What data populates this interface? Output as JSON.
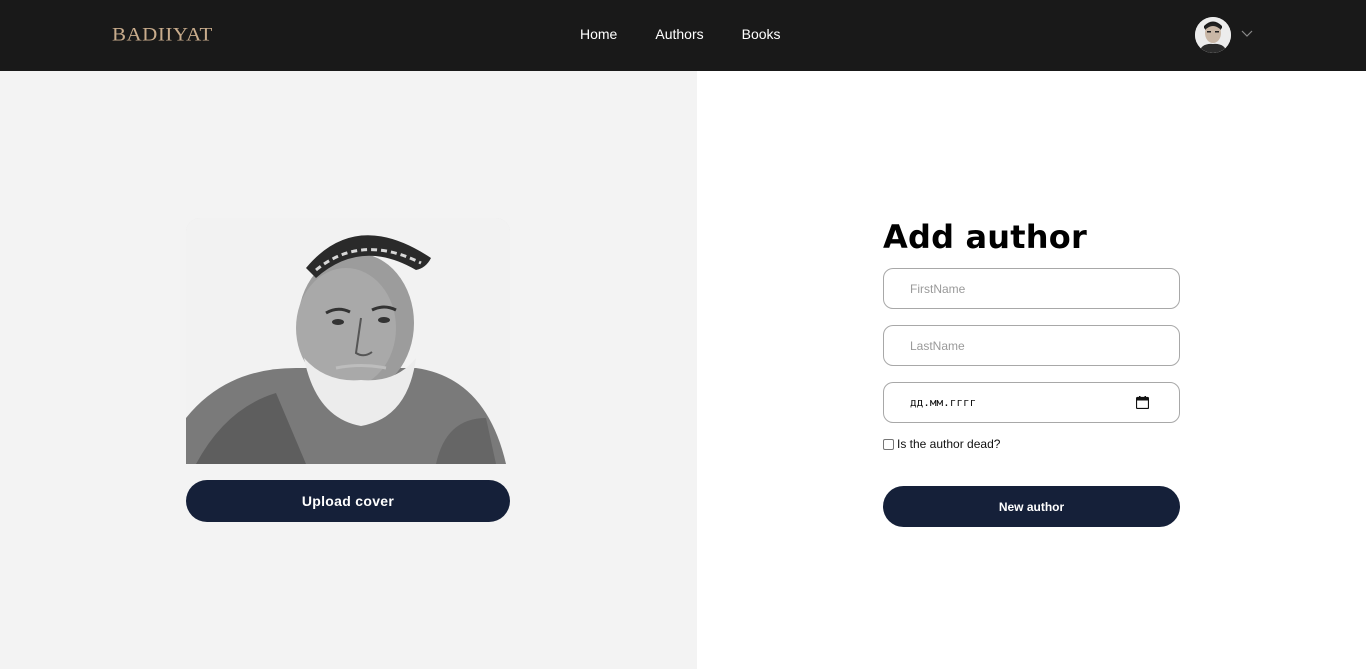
{
  "navbar": {
    "logo": "Badiiyat",
    "links": [
      {
        "label": "Home"
      },
      {
        "label": "Authors"
      },
      {
        "label": "Books"
      }
    ]
  },
  "left": {
    "upload_label": "Upload cover"
  },
  "form": {
    "title": "Add author",
    "first_name_placeholder": "FirstName",
    "last_name_placeholder": "LastName",
    "date_placeholder": "дд.мм.гггг",
    "dead_checkbox_label": "Is the author dead?",
    "submit_label": "New author"
  },
  "colors": {
    "navbar_bg": "#191919",
    "logo": "#c9ac8c",
    "button_bg": "#152039",
    "left_panel_bg": "#f3f3f3"
  }
}
